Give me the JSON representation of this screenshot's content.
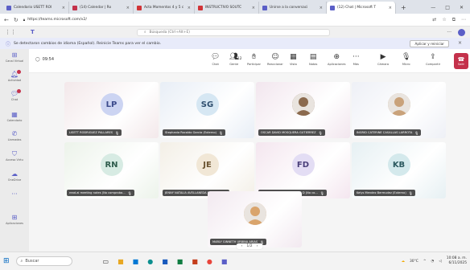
{
  "browser": {
    "tabs": [
      {
        "label": "Calendario USETT ROI",
        "favicon_color": "#5b5fc7",
        "active": false
      },
      {
        "label": "(14) Calendar | Ro",
        "favicon_color": "#c4314b",
        "active": false
      },
      {
        "label": "Acta Momentos 4 y 5 c",
        "favicon_color": "#d13438",
        "active": false
      },
      {
        "label": "INSTRUCTIVO SOUTC",
        "favicon_color": "#d13438",
        "active": false
      },
      {
        "label": "Unirse a la conversaci",
        "favicon_color": "#5b5fc7",
        "active": false
      },
      {
        "label": "(12) Chat | Microsoft T",
        "favicon_color": "#5b5fc7",
        "active": true
      }
    ],
    "new_tab_icon": "plus-icon",
    "url": "https://teams.microsoft.com/v2/"
  },
  "teams": {
    "search_placeholder": "Búsqueda (Ctrl+Alt+E)",
    "more_label": "···",
    "banner_text": "Se detectaron cambios de idioma (Español). Reinicie Teams para ver el cambio.",
    "banner_button": "Aplicar y reiniciar",
    "rail": [
      {
        "label": "Canal Virtual",
        "icon": "grid-icon"
      },
      {
        "label": "Actividad",
        "icon": "bell-icon"
      },
      {
        "label": "Chat",
        "icon": "chat-icon"
      },
      {
        "label": "Calendario",
        "icon": "calendar-icon"
      },
      {
        "label": "Llamadas",
        "icon": "phone-icon"
      },
      {
        "label": "Acceso Virtu",
        "icon": "shield-icon"
      },
      {
        "label": "OneDrive",
        "icon": "cloud-icon"
      },
      {
        "label": "···",
        "icon": "more-icon"
      },
      {
        "label": "Aplicaciones",
        "icon": "apps-icon"
      }
    ],
    "meeting": {
      "timer": "09:54",
      "participants_count": "12",
      "tools": [
        {
          "label": "Chat",
          "icon": "chat-icon"
        },
        {
          "label": "Gente",
          "icon": "people-icon"
        },
        {
          "label": "Participar",
          "icon": "hand-icon"
        },
        {
          "label": "Reaccionar",
          "icon": "smile-icon"
        },
        {
          "label": "Vista",
          "icon": "view-icon"
        },
        {
          "label": "Notas",
          "icon": "notes-icon"
        },
        {
          "label": "Aplicaciones",
          "icon": "apps-icon"
        },
        {
          "label": "Más",
          "icon": "more-icon"
        },
        {
          "label": "Cámara",
          "icon": "camera-icon"
        },
        {
          "label": "Micro",
          "icon": "mic-icon"
        },
        {
          "label": "Compartir",
          "icon": "share-icon"
        }
      ],
      "leave_label": "Salir"
    },
    "participants": [
      {
        "initials": "LP",
        "name": "LISETT RODRIGUEZ PALLARES",
        "avatar_bg": "#ccd4f2",
        "avatar_color": "#3b4a8c",
        "tile_bg": "#f3e8ea",
        "photo": false
      },
      {
        "initials": "SG",
        "name": "Stephania Rocaldo Garcia (Externo)",
        "avatar_bg": "#d6e7f3",
        "avatar_color": "#2f4f6f",
        "tile_bg": "#e8eef6",
        "photo": false
      },
      {
        "initials": "",
        "name": "OSCAR DAVID MOSQUERA GUTIERREZ",
        "avatar_bg": "#8b6a4e",
        "avatar_color": "#ffffff",
        "tile_bg": "#f2e6ee",
        "photo": true
      },
      {
        "initials": "",
        "name": "INGRID CATERINE CASALLAS LARROTA",
        "avatar_bg": "#c9a27a",
        "avatar_color": "#ffffff",
        "tile_bg": "#eef0f6",
        "photo": true
      },
      {
        "initials": "RN",
        "name": "read.ai meeting notes (No comproba...",
        "avatar_bg": "#d7ebe3",
        "avatar_color": "#2f5c4d",
        "tile_bg": "#ecf3ea",
        "photo": false
      },
      {
        "initials": "JE",
        "name": "JENNY NATALIA AVELLANEDA ESCUD...",
        "avatar_bg": "#f1e7d6",
        "avatar_color": "#6b5431",
        "tile_bg": "#f3efe6",
        "photo": false
      },
      {
        "initials": "FD",
        "name": "Fireflies.ai Notetaker OSCAR D (No co...",
        "avatar_bg": "#e3ddf4",
        "avatar_color": "#4a3f7a",
        "tile_bg": "#f4e6ef",
        "photo": false
      },
      {
        "initials": "KB",
        "name": "Kelys Mendez Bermudez (Externo)",
        "avatar_bg": "#d4e9ec",
        "avatar_color": "#2d5a60",
        "tile_bg": "#e6f0f3",
        "photo": false
      },
      {
        "initials": "",
        "name": "MARLY GINNETH URBINA ARIAS",
        "avatar_bg": "#d9a46c",
        "avatar_color": "#ffffff",
        "tile_bg": "#f2e9f0",
        "photo": true
      }
    ],
    "pager": "1/2"
  },
  "taskbar": {
    "search_label": "Buscar",
    "temperature": "30°C",
    "time": "10:08 a. m.",
    "date": "6/11/2025"
  },
  "colors": {
    "teams_purple": "#5b5fc7",
    "leave_red": "#c4314b"
  }
}
